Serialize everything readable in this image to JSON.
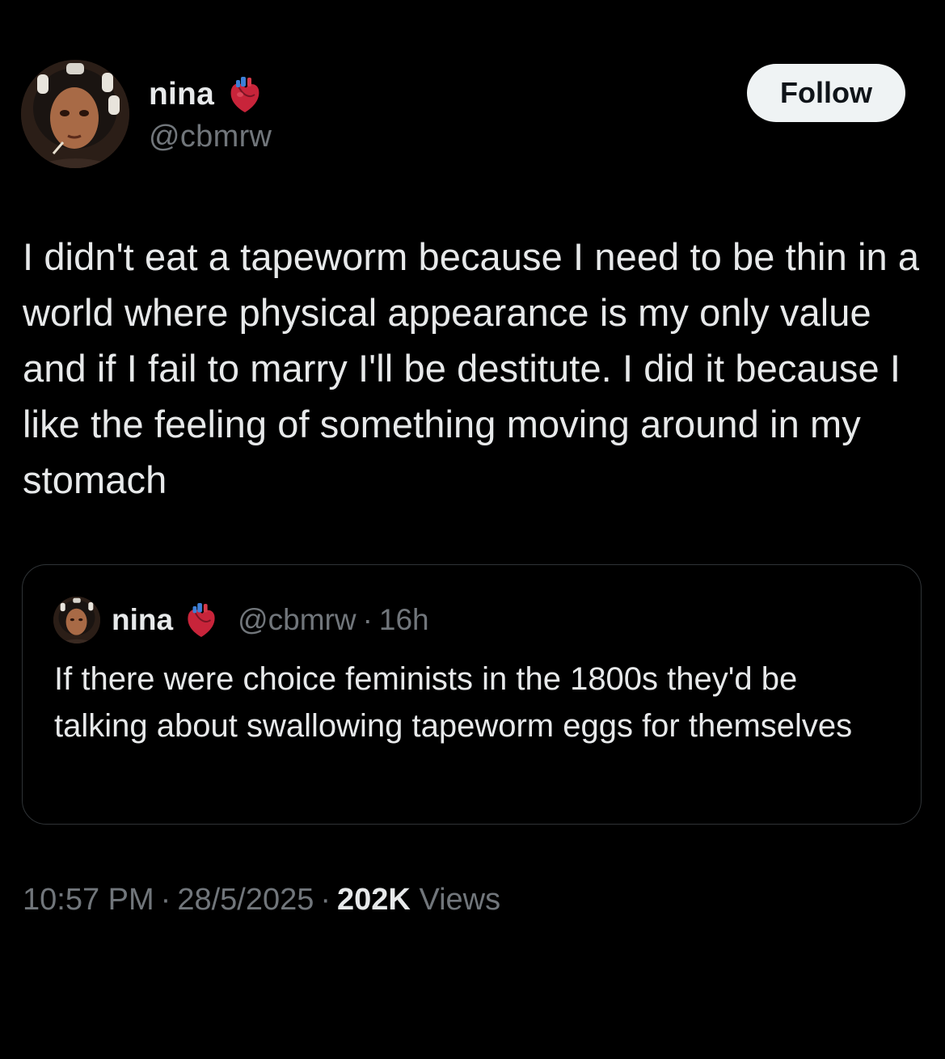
{
  "author": {
    "display_name": "nina",
    "handle": "@cbmrw",
    "badge_icon": "anatomical-heart-emoji"
  },
  "follow_button": {
    "label": "Follow"
  },
  "tweet": {
    "text": "I didn't eat a tapeworm because I need to be thin in a world where physical appearance is my only value and if I fail to marry I'll be destitute. I did it because I like the feeling of something moving around in my stomach"
  },
  "quoted_tweet": {
    "display_name": "nina",
    "handle": "@cbmrw",
    "separator": "·",
    "time": "16h",
    "text": "If there were choice feminists in the 1800s they'd be talking about swallowing tapeworm eggs for themselves"
  },
  "meta": {
    "time": "10:57 PM",
    "date": "28/5/2025",
    "views_count": "202K",
    "views_label": "Views",
    "separator": "·"
  },
  "colors": {
    "background": "#000000",
    "primary_text": "#e7e9ea",
    "secondary_text": "#71767b",
    "border": "#2f3336",
    "follow_bg": "#eff3f4"
  }
}
